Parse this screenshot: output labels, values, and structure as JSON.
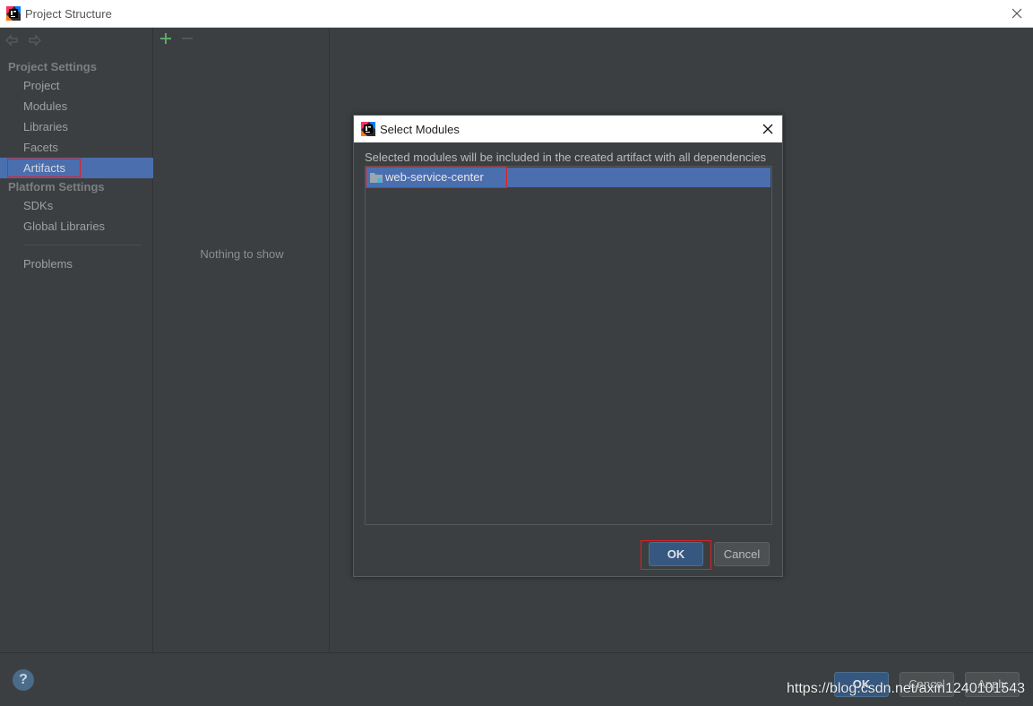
{
  "window": {
    "title": "Project Structure"
  },
  "sidebar": {
    "project_settings_header": "Project Settings",
    "project_items": [
      "Project",
      "Modules",
      "Libraries",
      "Facets",
      "Artifacts"
    ],
    "platform_settings_header": "Platform Settings",
    "platform_items": [
      "SDKs",
      "Global Libraries"
    ],
    "problems": "Problems",
    "selected": "Artifacts"
  },
  "middle": {
    "empty_text": "Nothing to show"
  },
  "dialog": {
    "title": "Select Modules",
    "message": "Selected modules will be included in the created artifact with all dependencies",
    "modules": [
      "web-service-center"
    ],
    "ok_label": "OK",
    "cancel_label": "Cancel"
  },
  "footer": {
    "help_label": "?",
    "ok_label": "OK",
    "cancel_label": "Cancel",
    "apply_label": "Apply",
    "watermark": "https://blog.csdn.net/axin1240101543"
  },
  "colors": {
    "background": "#3c3f41",
    "selection": "#4b6eaf",
    "primary_button": "#365880",
    "highlight_box": "#e02020"
  }
}
